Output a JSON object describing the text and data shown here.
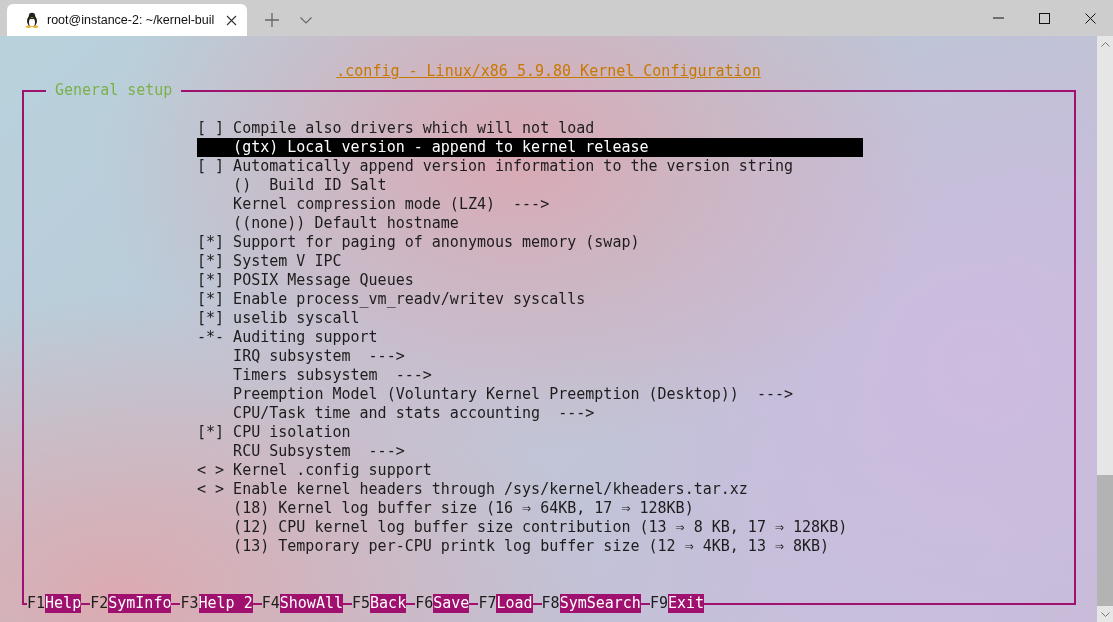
{
  "tab": {
    "title": "root@instance-2: ~/kernel-buil"
  },
  "title": ".config - Linux/x86 5.9.80 Kernel Configuration",
  "menu": {
    "heading": "General setup",
    "items": [
      {
        "prefix": "[ ]",
        "label": "Compile also drivers which will not load",
        "selected": false
      },
      {
        "label": "(gtx) Local version - append to kernel release",
        "selected": true
      },
      {
        "prefix": "[ ]",
        "label": "Automatically append version information to the version string",
        "selected": false
      },
      {
        "label": "()  Build ID Salt",
        "selected": false
      },
      {
        "label": "Kernel compression mode (LZ4)  --->",
        "selected": false
      },
      {
        "label": "((none)) Default hostname",
        "selected": false
      },
      {
        "prefix": "[*]",
        "label": "Support for paging of anonymous memory (swap)",
        "selected": false
      },
      {
        "prefix": "[*]",
        "label": "System V IPC",
        "selected": false
      },
      {
        "prefix": "[*]",
        "label": "POSIX Message Queues",
        "selected": false
      },
      {
        "prefix": "[*]",
        "label": "Enable process_vm_readv/writev syscalls",
        "selected": false
      },
      {
        "prefix": "[*]",
        "label": "uselib syscall",
        "selected": false
      },
      {
        "prefix": "-*-",
        "label": "Auditing support",
        "selected": false
      },
      {
        "label": "IRQ subsystem  --->",
        "selected": false
      },
      {
        "label": "Timers subsystem  --->",
        "selected": false
      },
      {
        "label": "Preemption Model (Voluntary Kernel Preemption (Desktop))  --->",
        "selected": false
      },
      {
        "label": "CPU/Task time and stats accounting  --->",
        "selected": false
      },
      {
        "prefix": "[*]",
        "label": "CPU isolation",
        "selected": false
      },
      {
        "label": "RCU Subsystem  --->",
        "selected": false
      },
      {
        "prefix": "< >",
        "label": "Kernel .config support",
        "selected": false
      },
      {
        "prefix": "< >",
        "label": "Enable kernel headers through /sys/kernel/kheaders.tar.xz",
        "selected": false
      },
      {
        "label": "(18) Kernel log buffer size (16 ⇒ 64KB, 17 ⇒ 128KB)",
        "selected": false
      },
      {
        "label": "(12) CPU kernel log buffer size contribution (13 ⇒ 8 KB, 17 ⇒ 128KB)",
        "selected": false
      },
      {
        "label": "(13) Temporary per-CPU printk log buffer size (12 ⇒ 4KB, 13 ⇒ 8KB)",
        "selected": false
      }
    ]
  },
  "function_keys": [
    {
      "key": "F1",
      "label": "Help"
    },
    {
      "key": "F2",
      "label": "SymInfo"
    },
    {
      "key": "F3",
      "label": "Help 2"
    },
    {
      "key": "F4",
      "label": "ShowAll"
    },
    {
      "key": "F5",
      "label": "Back"
    },
    {
      "key": "F6",
      "label": "Save"
    },
    {
      "key": "F7",
      "label": "Load"
    },
    {
      "key": "F8",
      "label": "SymSearch"
    },
    {
      "key": "F9",
      "label": "Exit"
    }
  ]
}
